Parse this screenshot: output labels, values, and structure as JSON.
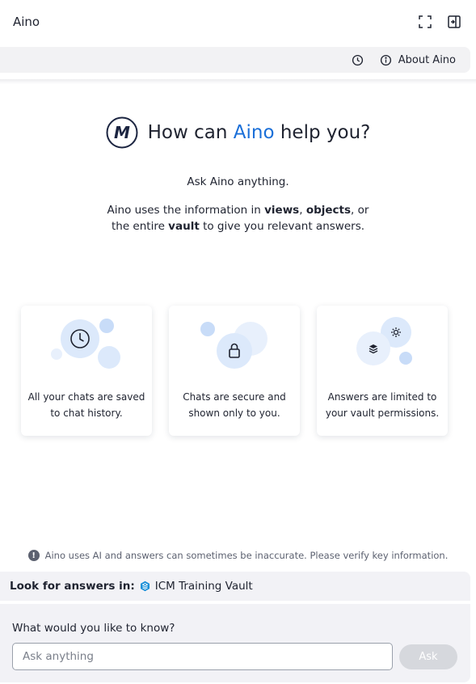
{
  "header": {
    "app_title": "Aino",
    "icons": [
      "expand-icon",
      "close-panel-icon"
    ]
  },
  "toolbar": {
    "history_icon": "clock-icon",
    "about_label": "About Aino",
    "about_icon": "info-icon"
  },
  "hero": {
    "logo_letter": "M",
    "title_before": "How can ",
    "title_brand": "Aino",
    "title_after": " help you?",
    "lead": "Ask Aino anything.",
    "desc_1": "Aino uses the information in ",
    "desc_views": "views",
    "desc_2": ", ",
    "desc_objects": "objects",
    "desc_3": ", or",
    "desc_4": "the entire ",
    "desc_vault": "vault",
    "desc_5": " to give you relevant answers."
  },
  "cards": [
    {
      "icon": "clock-icon",
      "line1": "All your chats are saved",
      "line2": "to chat history."
    },
    {
      "icon": "lock-icon",
      "line1": "Chats are secure and",
      "line2": "shown only to you."
    },
    {
      "icon": "settings-icon",
      "line1": "Answers are limited to",
      "line2": "your vault permissions."
    }
  ],
  "disclaimer": {
    "icon_glyph": "!",
    "text": "Aino uses AI and answers can sometimes be inaccurate. Please verify key information."
  },
  "scope": {
    "label": "Look for answers in:",
    "vault_name": "ICM Training Vault"
  },
  "compose": {
    "question": "What would you like to know?",
    "placeholder": "Ask anything",
    "ask_label": "Ask"
  },
  "colors": {
    "brand": "#1a6fd8",
    "bubble": "#dce9fb",
    "panel": "#f2f2f6"
  }
}
